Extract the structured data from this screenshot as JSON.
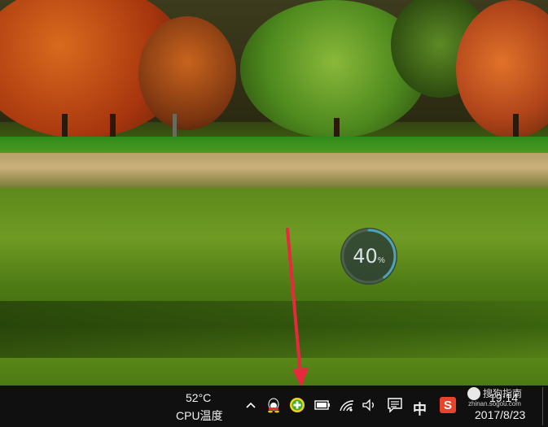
{
  "desktop": {
    "wallpaper": "autumn-meadow-wallpaper"
  },
  "widget": {
    "percent_label": "40",
    "unit": "%",
    "progress": 0.4,
    "accent": "#4fa3b8"
  },
  "taskbar": {
    "cpu_temp": "52°C",
    "cpu_label": "CPU温度",
    "input_method": "中",
    "time": "19:14",
    "date": "2017/8/23",
    "icons": [
      "chevron-up-icon",
      "qq-penguin-icon",
      "security-plus-icon",
      "battery-icon",
      "wifi-icon",
      "volume-icon",
      "action-center-icon",
      "ime-chinese-icon",
      "sogou-input-icon"
    ]
  },
  "watermark": {
    "brand": "搜狗指南",
    "url": "zhinan.sogou.com"
  },
  "colors": {
    "taskbar_bg": "#101010",
    "arrow": "#e8283c",
    "plus_icon_green": "#3fae2a"
  }
}
